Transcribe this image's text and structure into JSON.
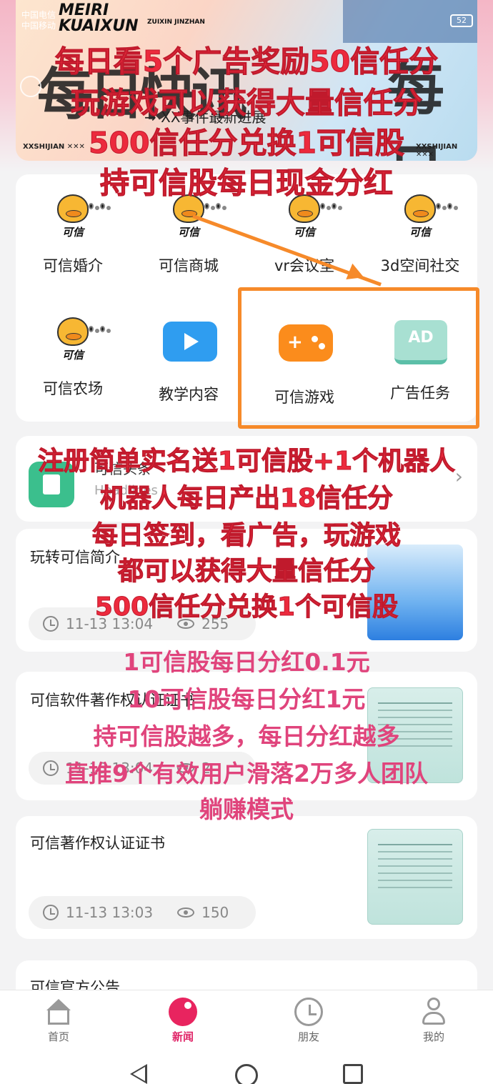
{
  "status_bar": {
    "carrier1": "中国电信",
    "carrier2": "中国移动",
    "battery": "52"
  },
  "banner": {
    "logo_line1": "MEIRI",
    "logo_line2": "KUAIXUN",
    "logo_sub": "ZUIXIN JINZHAN",
    "tagline": "→ XX事件最新进展",
    "big_left": "每日快讯",
    "big_right": "每日",
    "footer_left": "XXSHIJIAN ✕✕✕",
    "footer_right": "XXSHIJIAN ✕✕✕"
  },
  "overlay_red": [
    "每日看5个广告奖励50信任分",
    "玩游戏可以获得大量信任分",
    "500信任分兑换1可信股",
    "持可信股每日现金分红",
    "注册简单实名送1可信股+1个机器人",
    "机器人每日产出18信任分",
    "每日签到，看广告，玩游戏",
    "都可以获得大量信任分",
    "500信任分兑换1个可信股"
  ],
  "overlay_pink": [
    "1可信股每日分红0.1元",
    "10可信股每日分红1元",
    "持可信股越多，每日分红越多",
    "直推9个有效用户滑落2万多人团队",
    "躺赚模式"
  ],
  "grid": {
    "items": [
      {
        "label": "可信婚介",
        "icon": "kexin-duck-icon",
        "duck_text": "可信"
      },
      {
        "label": "可信商城",
        "icon": "kexin-duck-icon",
        "duck_text": "可信"
      },
      {
        "label": "vr会议室",
        "icon": "kexin-duck-icon",
        "duck_text": "可信"
      },
      {
        "label": "3d空间社交",
        "icon": "kexin-duck-icon",
        "duck_text": "可信"
      },
      {
        "label": "可信农场",
        "icon": "kexin-duck-icon",
        "duck_text": "可信"
      },
      {
        "label": "教学内容",
        "icon": "video-play-icon"
      },
      {
        "label": "可信游戏",
        "icon": "gamepad-icon"
      },
      {
        "label": "广告任务",
        "icon": "ad-icon",
        "badge": "AD"
      }
    ]
  },
  "headlines": {
    "title": "可信头条",
    "subtitle": "Headlines"
  },
  "news": [
    {
      "title": "玩转可信简介",
      "time": "11-13 13:04",
      "views": "255"
    },
    {
      "title": "可信软件著作权认证证书",
      "time": "11-13 13:04",
      "views": "2"
    },
    {
      "title": "可信著作权认证证书",
      "time": "11-13 13:03",
      "views": "150"
    },
    {
      "title": "可信官方公告"
    }
  ],
  "tabbar": [
    {
      "label": "首页",
      "icon": "home-icon"
    },
    {
      "label": "新闻",
      "icon": "news-icon",
      "active": true
    },
    {
      "label": "朋友",
      "icon": "clock-icon"
    },
    {
      "label": "我的",
      "icon": "user-icon"
    }
  ],
  "colors": {
    "overlay_red": "#ec2a3d",
    "overlay_pink": "#e0447c",
    "highlight_orange": "#f68a2a",
    "active_tab": "#e02467"
  }
}
